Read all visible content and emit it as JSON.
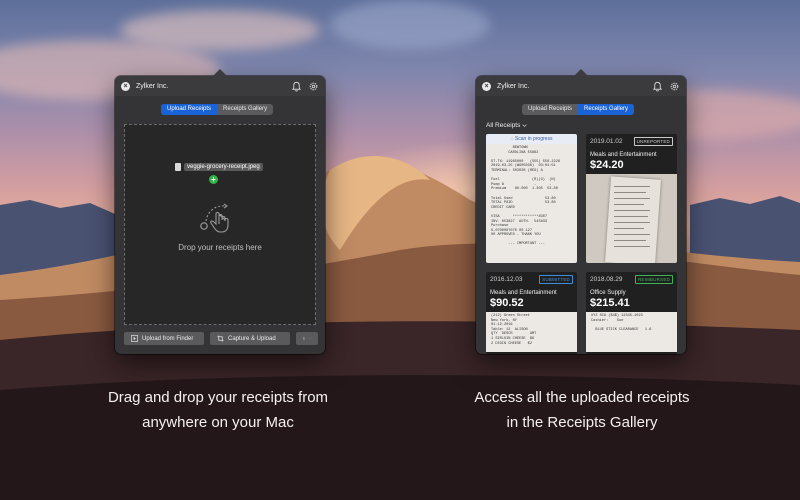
{
  "left_window": {
    "title": "Zylker Inc.",
    "tabs": [
      {
        "label": "Upload Receipts",
        "active": true
      },
      {
        "label": "Receipts Gallery",
        "active": false
      }
    ],
    "dragged_file": "veggie-grocery-receipt.jpeg",
    "drop_text": "Drop your receipts here",
    "buttons": {
      "upload_finder": "Upload from Finder",
      "capture_upload": "Capture & Upload"
    }
  },
  "right_window": {
    "title": "Zylker Inc.",
    "tabs": [
      {
        "label": "Upload Receipts",
        "active": false
      },
      {
        "label": "Receipts Gallery",
        "active": true
      }
    ],
    "filter": "All Receipts",
    "scan_status": "Scan in progress",
    "scan_receipt_lines": [
      "          NEWTOWN",
      "        CAROLINA 55862",
      "",
      "ST-TX: 11985000   (555) 556-2226",
      "2019-03-25 (WG05036)  03:04:51",
      "TERMINAL: 503038 (REG) A",
      "",
      "Fuel               (R)(G)  (N)",
      "Pump 8              -      -",
      "Premium    80.000  1.305  53.80",
      "",
      "Total Used               53.80",
      "TOTAL PAID               53.80",
      "CREDIT CARD",
      "",
      "VISA      ************8307",
      "INV. 053827  AUTH.  545833",
      "Purchase",
      "S-0700007070 00 127",
      "00 APPROVED - THANK YOU",
      "",
      "        --- IMPORTANT ---"
    ],
    "receipts": [
      {
        "date": "2019.01.02",
        "status": "UNREPORTED",
        "status_color": "#c9c9c9",
        "category": "Meals and Entertainment",
        "amount": "$24.20"
      },
      {
        "date": "2016.12.03",
        "status": "SUBMITTED",
        "status_color": "#3c8dde",
        "category": "Meals and Entertainment",
        "amount": "$90.52"
      },
      {
        "date": "2018.08.29",
        "status": "REIMBURSED",
        "status_color": "#3fb357",
        "category": "Office Supply",
        "amount": "$215.41"
      }
    ],
    "small_receipt_texts": {
      "r2": [
        "(212) Green Street",
        "New York, NY",
        "01.12.2016",
        "Table: 12  ALISON",
        "QTY  DESCR        AMT",
        "1 SIRLOIN CHEESE  $6",
        "2 DIGIN CHEESE   $2"
      ],
      "r3": [
        "XYZ SCA ($4$) 12345-1023",
        "Cashier:    Sue",
        "",
        "  BLUE STICK CLEARANCE   1.6"
      ]
    }
  },
  "captions": {
    "left": [
      "Drag and drop your receipts from",
      "anywhere on your Mac"
    ],
    "right": [
      "Access all the uploaded receipts",
      "in the Receipts Gallery"
    ]
  }
}
